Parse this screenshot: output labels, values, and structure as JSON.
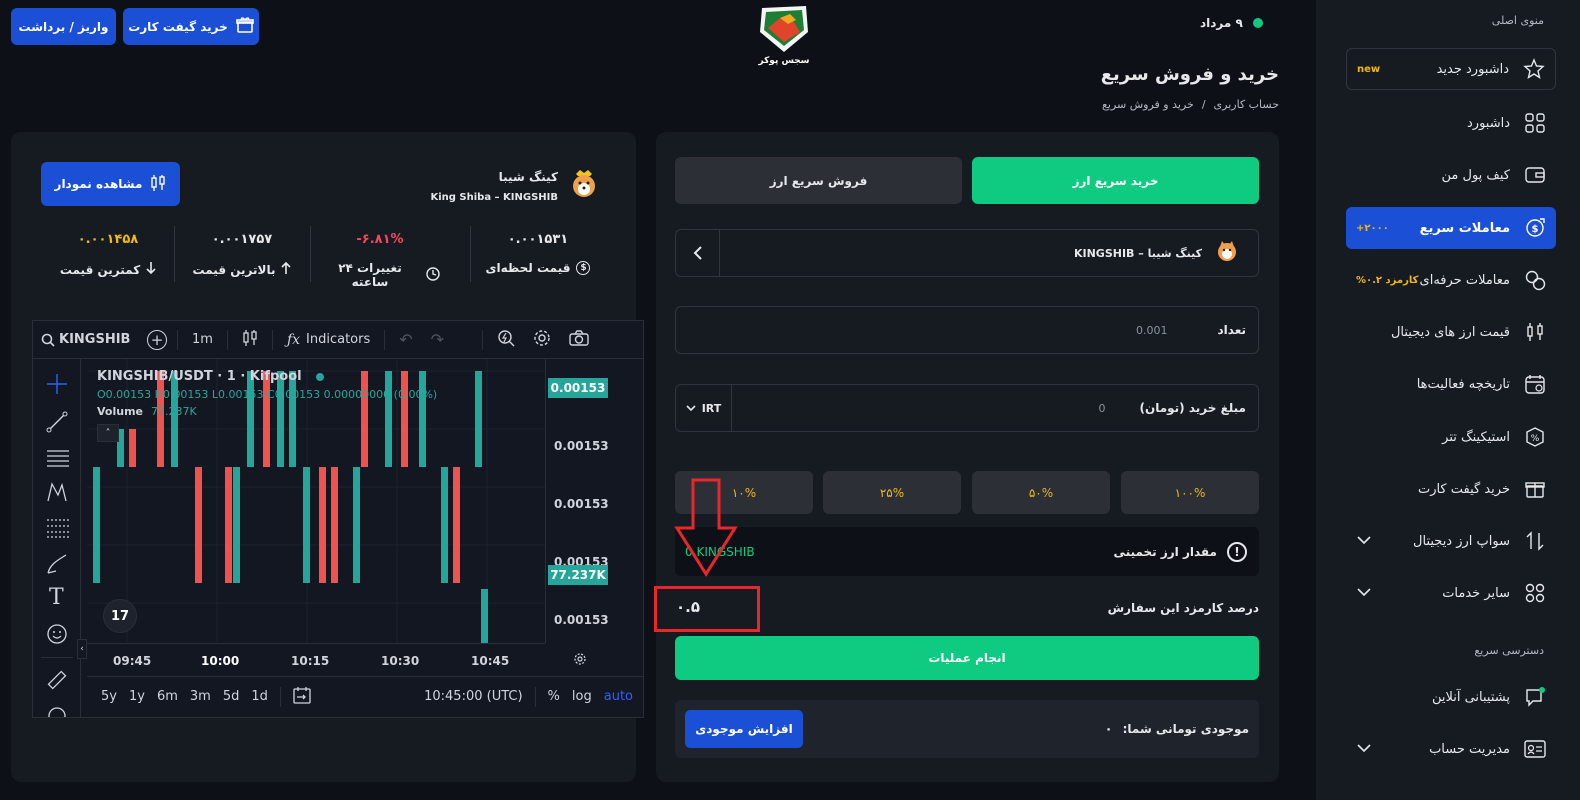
{
  "topbar": {
    "deposit_label": "واریز / برداشت",
    "giftcard_label": "خرید گیفت کارت",
    "logo_text": "سجس پوکر",
    "date": "۹ مرداد"
  },
  "page": {
    "title": "خرید و فروش سریع",
    "breadcrumb_root": "حساب کاربری",
    "breadcrumb_sep": "/",
    "breadcrumb_current": "خرید و فروش سریع"
  },
  "trade": {
    "tab_buy": "خرید سریع ارز",
    "tab_sell": "فروش سریع ارز",
    "coin_name": "کینگ شیبا – KINGSHIB",
    "qty_label": "تعداد",
    "qty_value": "0.001",
    "amount_label": "مبلغ خرید (تومان)",
    "amount_value": "0",
    "currency": "IRT",
    "pct": [
      "۱۰۰%",
      "۵۰%",
      "۲۵%",
      "۱۰%"
    ],
    "estimate_label": "مقدار ارز تخمینی",
    "estimate_value": "0 KINGSHIB",
    "fee_label": "درصد کارمزد این سفارش",
    "fee_value": "۰.۵",
    "submit_label": "انجام عملیات",
    "balance_label": "موجودی تومانی شما:",
    "balance_value": "۰",
    "increase_label": "افزایش موجودی"
  },
  "coin": {
    "name_fa": "کینگ شیبا",
    "name_en": "King Shiba – KINGSHIB",
    "view_chart": "مشاهده نمودار",
    "stats": [
      {
        "value": "۰.۰۰۱۵۳۱",
        "label": "قیمت لحظه‌ای",
        "color": "#e6e8eb"
      },
      {
        "value": "-۶.۸۱%",
        "label": "تغییرات ۲۴ ساعته",
        "color": "#f6465d"
      },
      {
        "value": "۰.۰۰۱۷۵۷",
        "label": "بالاترین قیمت",
        "color": "#e6e8eb"
      },
      {
        "value": "۰.۰۰۱۴۵۸",
        "label": "کمترین قیمت",
        "color": "#f0b90b"
      }
    ]
  },
  "tv": {
    "symbol": "KINGSHIB",
    "interval": "1m",
    "indicators": "Indicators",
    "title": "KINGSHIB/USDT · 1 · Kifpool",
    "ohlc": "O0.00153 H0.00153 L0.00153 C0.00153 0.00000000 (0.00%)",
    "volume_label": "Volume",
    "volume_value": "77.237K",
    "price_ticks": [
      "0.00153",
      "0.00153",
      "0.00153",
      "0.00153",
      "0.00153"
    ],
    "last_price": "0.00153",
    "vol_tag": "77.237K",
    "time_ticks": [
      "09:45",
      "10:00",
      "10:15",
      "10:30",
      "10:45"
    ],
    "ranges": [
      "5y",
      "1y",
      "6m",
      "3m",
      "5d",
      "1d"
    ],
    "clock": "10:45:00 (UTC)",
    "pct": "%",
    "log": "log",
    "auto": "auto",
    "colors": {
      "up": "#26a69a",
      "down": "#ef5350"
    }
  },
  "sidebar": {
    "menu_title": "منوی اصلی",
    "items": [
      {
        "label": "داشبورد جدید",
        "badge": "new",
        "icon": "star-badge-icon"
      },
      {
        "label": "داشبورد",
        "icon": "grid-icon"
      },
      {
        "label": "کیف پول من",
        "icon": "wallet-icon"
      },
      {
        "label": "معاملات سریع",
        "badge": "+۲۰۰۰",
        "icon": "dollar-exchange-icon"
      },
      {
        "label": "معاملات حرفه‌ای",
        "badge": "کارمزد ۰.۲%",
        "icon": "coins-icon"
      },
      {
        "label": "قیمت ارز های دیجیتال",
        "icon": "candles-icon"
      },
      {
        "label": "تاریخچه فعالیت‌ها",
        "icon": "calendar-icon"
      },
      {
        "label": "استیکینگ تتر",
        "icon": "staking-icon"
      },
      {
        "label": "خرید گیفت کارت",
        "icon": "gift-icon"
      },
      {
        "label": "سواپ ارز دیجیتال",
        "icon": "swap-icon"
      },
      {
        "label": "سایر خدمات",
        "icon": "grid-icon"
      }
    ],
    "quick_title": "دسترسی سریع",
    "quick_items": [
      {
        "label": "پشتیبانی آنلاین",
        "icon": "chat-icon"
      },
      {
        "label": "مدیریت حساب",
        "icon": "id-card-icon"
      }
    ]
  }
}
